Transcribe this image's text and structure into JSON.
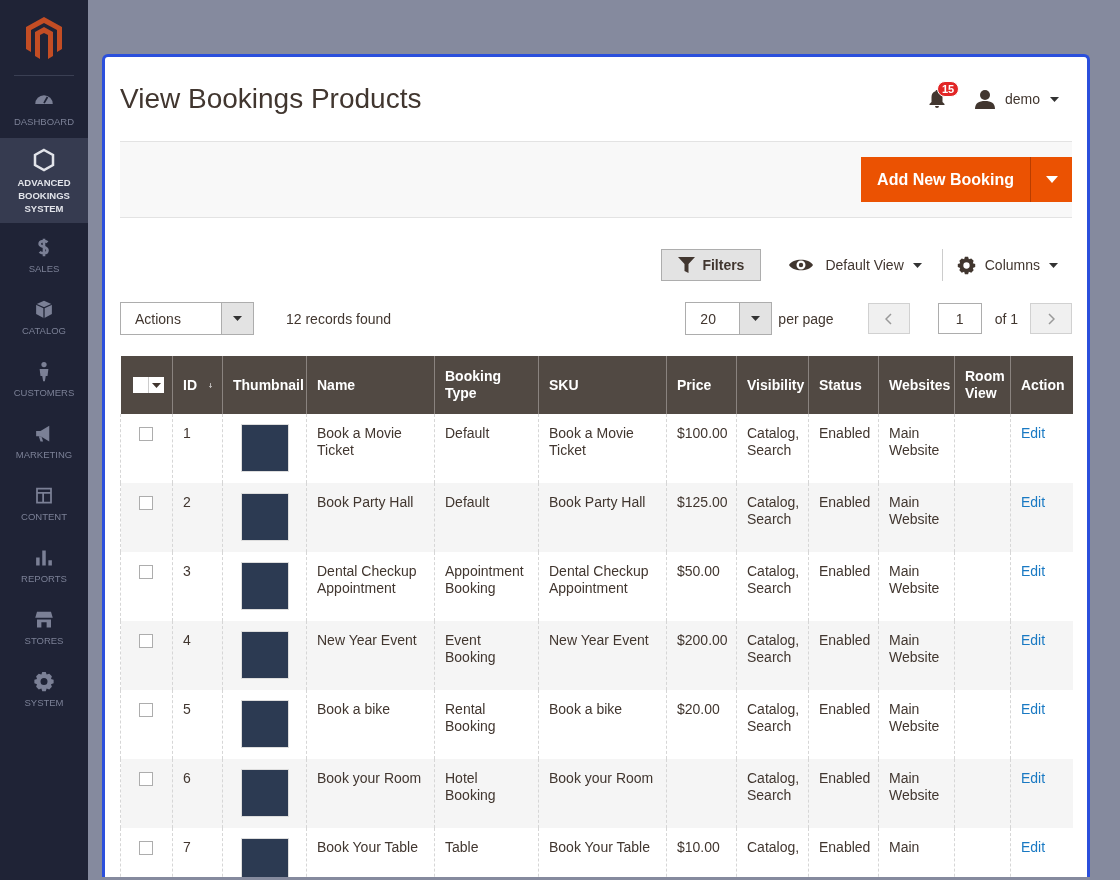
{
  "sidebar": {
    "items": [
      {
        "label": "DASHBOARD",
        "selected": false
      },
      {
        "label": "ADVANCED BOOKINGS SYSTEM",
        "selected": true
      },
      {
        "label": "SALES",
        "selected": false
      },
      {
        "label": "CATALOG",
        "selected": false
      },
      {
        "label": "CUSTOMERS",
        "selected": false
      },
      {
        "label": "MARKETING",
        "selected": false
      },
      {
        "label": "CONTENT",
        "selected": false
      },
      {
        "label": "REPORTS",
        "selected": false
      },
      {
        "label": "STORES",
        "selected": false
      },
      {
        "label": "SYSTEM",
        "selected": false
      }
    ]
  },
  "header": {
    "title": "View Bookings Products",
    "notifications": "15",
    "user": "demo"
  },
  "page_actions": {
    "primary_button": "Add New Booking"
  },
  "toolbar": {
    "filters": "Filters",
    "view": "Default View",
    "columns": "Columns",
    "actions": "Actions",
    "records": "12 records found",
    "per_page_value": "20",
    "per_page_label": "per page",
    "page_value": "1",
    "page_total": "of 1"
  },
  "table": {
    "select_all": {
      "checked": false
    },
    "columns": [
      {
        "label": "ID",
        "sorted": true
      },
      {
        "label": "Thumbnail",
        "sorted": false
      },
      {
        "label": "Name",
        "sorted": false
      },
      {
        "label": "Booking Type",
        "sorted": false
      },
      {
        "label": "SKU",
        "sorted": false
      },
      {
        "label": "Price",
        "sorted": false
      },
      {
        "label": "Visibility",
        "sorted": false
      },
      {
        "label": "Status",
        "sorted": false
      },
      {
        "label": "Websites",
        "sorted": false
      },
      {
        "label": "Room View",
        "sorted": false
      },
      {
        "label": "Action",
        "sorted": false
      }
    ],
    "rows": [
      {
        "checked": false,
        "id": "1",
        "name": "Book a Movie Ticket",
        "booking_type": "Default",
        "sku": "Book a Movie Ticket",
        "price": "$100.00",
        "visibility": "Catalog, Search",
        "status": "Enabled",
        "websites": "Main Website",
        "action": "Edit"
      },
      {
        "checked": false,
        "id": "2",
        "name": "Book Party Hall",
        "booking_type": "Default",
        "sku": "Book Party Hall",
        "price": "$125.00",
        "visibility": "Catalog, Search",
        "status": "Enabled",
        "websites": "Main Website",
        "action": "Edit"
      },
      {
        "checked": false,
        "id": "3",
        "name": "Dental Checkup Appointment",
        "booking_type": "Appointment Booking",
        "sku": "Dental Checkup Appointment",
        "price": "$50.00",
        "visibility": "Catalog, Search",
        "status": "Enabled",
        "websites": "Main Website",
        "action": "Edit"
      },
      {
        "checked": false,
        "id": "4",
        "name": "New Year Event",
        "booking_type": "Event Booking",
        "sku": "New Year Event",
        "price": "$200.00",
        "visibility": "Catalog, Search",
        "status": "Enabled",
        "websites": "Main Website",
        "action": "Edit"
      },
      {
        "checked": false,
        "id": "5",
        "name": "Book a bike",
        "booking_type": "Rental Booking",
        "sku": "Book a bike",
        "price": "$20.00",
        "visibility": "Catalog, Search",
        "status": "Enabled",
        "websites": "Main Website",
        "action": "Edit"
      },
      {
        "checked": false,
        "id": "6",
        "name": "Book your Room",
        "booking_type": "Hotel Booking",
        "sku": "Book your Room",
        "visibility": "Catalog, Search",
        "status": "Enabled",
        "websites": "Main Website",
        "action": "Edit"
      },
      {
        "checked": false,
        "id": "7",
        "name": "Book Your Table",
        "booking_type": "Table",
        "sku": "Book Your Table",
        "price": "$10.00",
        "visibility": "Catalog,",
        "status": "Enabled",
        "websites": "Main",
        "action": "Edit"
      }
    ]
  }
}
